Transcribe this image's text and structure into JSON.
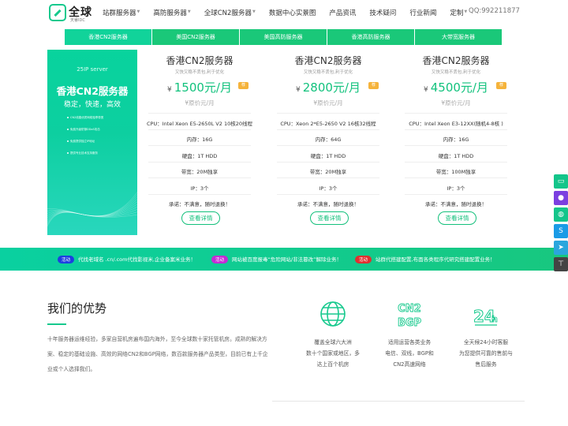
{
  "header": {
    "logo_main": "全球",
    "logo_sub": "天睿IDC",
    "nav": [
      {
        "label": "站群服务器",
        "dropdown": true
      },
      {
        "label": "高防服务器",
        "dropdown": true
      },
      {
        "label": "全球CN2服务器",
        "dropdown": true
      },
      {
        "label": "数据中心实景图",
        "dropdown": false
      },
      {
        "label": "产品资讯",
        "dropdown": false
      },
      {
        "label": "技术疑问",
        "dropdown": false
      },
      {
        "label": "行业新闻",
        "dropdown": false
      },
      {
        "label": "定制",
        "dropdown": true
      }
    ],
    "qq": "QQ:992211877"
  },
  "tabs": [
    {
      "label": "香港CN2服务器",
      "active": true
    },
    {
      "label": "美国CN2服务器",
      "active": false
    },
    {
      "label": "美国高防服务器",
      "active": false
    },
    {
      "label": "香港高防服务器",
      "active": false
    },
    {
      "label": "大带宽服务器",
      "active": false
    }
  ],
  "promo": {
    "tag": "25IP server",
    "title": "香港CN2服务器",
    "subtitle": "稳定，快速，高效",
    "features": [
      "CN2线路优质网络独享带宽",
      "免费升级防御DDoS攻击",
      "免费提供独立IP地址",
      "提供专业技术支持服务"
    ]
  },
  "products": [
    {
      "name": "香港CN2服务器",
      "desc": "又快又稳不丢包,利于优化",
      "currency": "¥",
      "price": "1500元/月",
      "flag": "荐",
      "orig": "¥原价元/月",
      "specs": [
        "CPU：Intel Xeon E5-2650L V2 10核20线程",
        "内存：16G",
        "硬盘：1T HDD",
        "带宽：20M独享",
        "IP：3个",
        "承诺：不满意，随时退换！"
      ],
      "button": "查看详情"
    },
    {
      "name": "香港CN2服务器",
      "desc": "又快又稳不丢包,利于优化",
      "currency": "¥",
      "price": "2800元/月",
      "flag": "荐",
      "orig": "¥原价元/月",
      "specs": [
        "CPU：Xeon 2*E5-2650 V2 16核32线程",
        "内存：64G",
        "硬盘：1T HDD",
        "带宽：20M独享",
        "IP：3个",
        "承诺：不满意，随时退换！"
      ],
      "button": "查看详情"
    },
    {
      "name": "香港CN2服务器",
      "desc": "又快又稳不丢包,利于优化",
      "currency": "¥",
      "price": "4500元/月",
      "flag": "荐",
      "orig": "¥原价元/月",
      "specs": [
        "CPU：Intel Xeon E3-12XX(随机4-8核 )",
        "内存：16G",
        "硬盘：1T HDD",
        "带宽：100M独享",
        "IP：3个",
        "承诺：不满意，随时退换！"
      ],
      "button": "查看详情"
    }
  ],
  "ticker": [
    {
      "badge": "活动",
      "text": "代找老域名 .cn/.com代找影视米,企业备案米业务！",
      "color": "#1d3fe0"
    },
    {
      "badge": "活动",
      "text": "网站被百度报毒“危险网站/非法篡改”解除业务！",
      "color": "#c42bd6"
    },
    {
      "badge": "活动",
      "text": "站群代搭建配置,布面各类程序代研究搭建配置业务！",
      "color": "#e03030"
    }
  ],
  "advantages": {
    "title": "我们的优势",
    "text": "十年服务器运维经验，多家自营机房遍布国内海外，至今全球数十家托管机房。成熟的解决方案、稳定的基础设施、高效的网络CN2和BGP网络，数百款服务器产品类型，目前已有上千企业或个人选择我们。",
    "features": [
      {
        "icon": "globe-icon",
        "lines": [
          "覆盖全球六大洲",
          "数十个国家或地区，多",
          "达上百个机房"
        ]
      },
      {
        "icon": "cn2-bgp-icon",
        "lines": [
          "适用运营各类业务",
          "电信、双线，BGP和",
          "CN2高速网络"
        ]
      },
      {
        "icon": "support-24h-icon",
        "lines": [
          "全天候24小时客服",
          "为您提供可靠的售前与",
          "售后服务"
        ]
      }
    ],
    "icon_labels": {
      "cn2": "CN2",
      "bgp": "BGP",
      "h24": "24",
      "h": "h"
    }
  },
  "rail": [
    "chat-icon",
    "qq-icon",
    "wechat-icon",
    "skype-icon",
    "telegram-icon",
    "back-to-top-icon"
  ],
  "colors": {
    "accent": "#16c98d",
    "price": "#12c27d",
    "flag": "#f5b33b"
  }
}
